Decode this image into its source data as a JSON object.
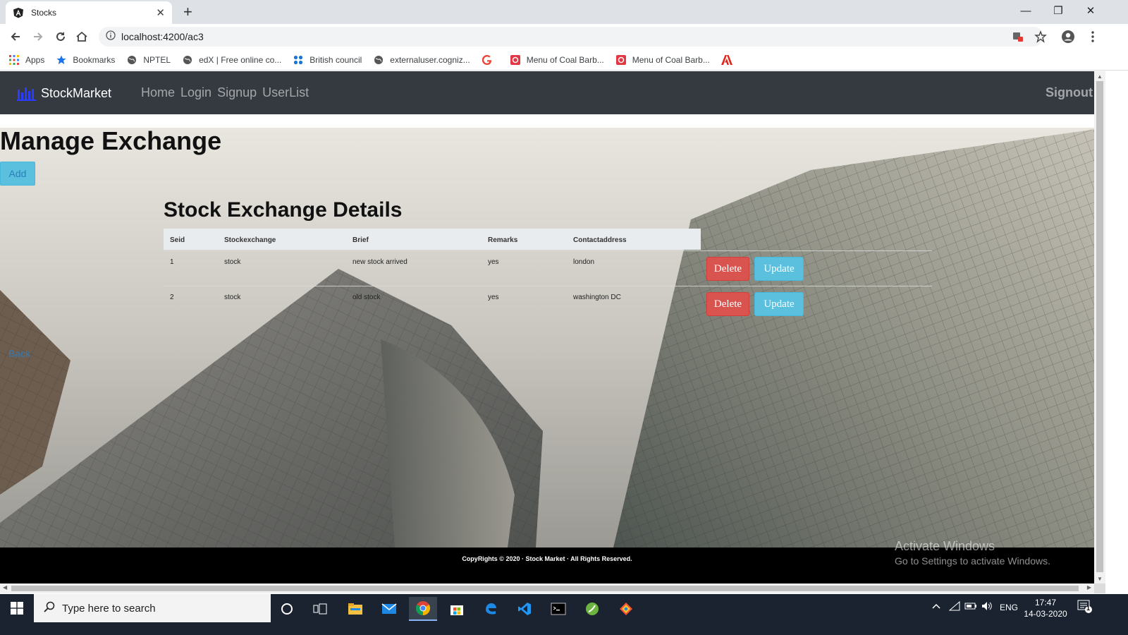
{
  "browser": {
    "tab_title": "Stocks",
    "url": "localhost:4200/ac3",
    "bookmarks": [
      {
        "label": "Apps",
        "icon": "apps-grid-icon"
      },
      {
        "label": "Bookmarks",
        "icon": "star-icon"
      },
      {
        "label": "NPTEL",
        "icon": "globe-icon"
      },
      {
        "label": "edX | Free online co...",
        "icon": "globe-icon"
      },
      {
        "label": "British council",
        "icon": "dots-icon"
      },
      {
        "label": "externaluser.cogniz...",
        "icon": "globe-icon"
      },
      {
        "label": "",
        "icon": "google-icon"
      },
      {
        "label": "Menu of Coal Barb...",
        "icon": "zomato-icon"
      },
      {
        "label": "Menu of Coal Barb...",
        "icon": "zomato-icon"
      },
      {
        "label": "",
        "icon": "adobe-icon"
      }
    ]
  },
  "navbar": {
    "brand": "StockMarket",
    "links": [
      "Home",
      "Login",
      "Signup",
      "UserList"
    ],
    "signout": "Signout"
  },
  "page": {
    "title": "Manage Exchange",
    "add_label": "Add",
    "section_title": "Stock Exchange Details",
    "back_label": "Back"
  },
  "table": {
    "headers": [
      "Seid",
      "Stockexchange",
      "Brief",
      "Remarks",
      "Contactaddress"
    ],
    "rows": [
      [
        "1",
        "stock",
        "new stock arrived",
        "yes",
        "london"
      ],
      [
        "2",
        "stock",
        "old stock",
        "yes",
        "washington DC"
      ]
    ],
    "delete_label": "Delete",
    "update_label": "Update"
  },
  "footer": {
    "text": "CopyRights © 2020 · Stock Market · All Rights Reserved."
  },
  "watermark": {
    "line1": "Activate Windows",
    "line2": "Go to Settings to activate Windows."
  },
  "taskbar": {
    "search_placeholder": "Type here to search",
    "language": "ENG",
    "time": "17:47",
    "date": "14-03-2020",
    "notifications": "1"
  },
  "colors": {
    "navbar": "#343a40",
    "danger": "#d9534f",
    "info": "#5bc0de",
    "footer": "#000000"
  }
}
